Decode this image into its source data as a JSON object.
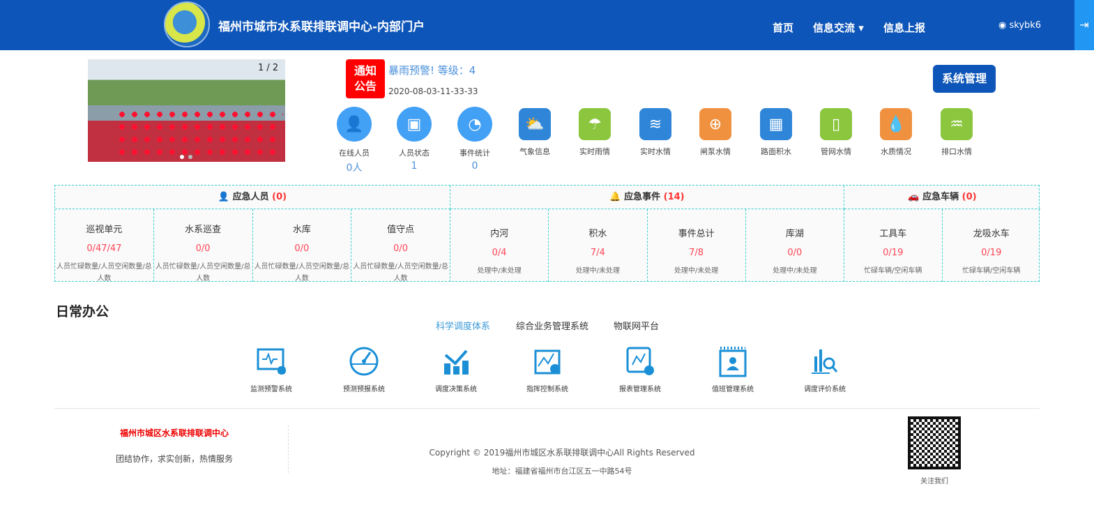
{
  "header": {
    "title": "福州市城市水系联排联调中心-内部门户",
    "nav": [
      "首页",
      "信息交流 ▾",
      "信息上报"
    ],
    "user": "skybk6",
    "logout_icon": "sign-out-icon"
  },
  "carousel": {
    "pager": "1 / 2"
  },
  "notice": {
    "badge": "通知公告",
    "title": "暴雨预警! 等级：4",
    "date": "2020-08-03-11-33-33"
  },
  "system_button": "系统管理",
  "quick": [
    {
      "label": "在线人员",
      "value": "0人",
      "color": "#42a0f5",
      "glyph": "👤"
    },
    {
      "label": "人员状态",
      "value": "1",
      "color": "#42a0f5",
      "glyph": "▣"
    },
    {
      "label": "事件统计",
      "value": "0",
      "color": "#42a0f5",
      "glyph": "◔"
    },
    {
      "label": "气象信息",
      "color": "#2f86d9",
      "glyph": "⛅"
    },
    {
      "label": "实时雨情",
      "color": "#8cc63f",
      "glyph": "☂"
    },
    {
      "label": "实时水情",
      "color": "#2f86d9",
      "glyph": "≋"
    },
    {
      "label": "闸泵水情",
      "color": "#f0913f",
      "glyph": "⊕"
    },
    {
      "label": "路面积水",
      "color": "#2f86d9",
      "glyph": "▦"
    },
    {
      "label": "管网水情",
      "color": "#8cc63f",
      "glyph": "▯"
    },
    {
      "label": "水质情况",
      "color": "#f0913f",
      "glyph": "💧"
    },
    {
      "label": "排口水情",
      "color": "#8cc63f",
      "glyph": "♒"
    }
  ],
  "emergency": {
    "groups": [
      {
        "title": "应急人员",
        "count": "(0)"
      },
      {
        "title": "应急事件",
        "count": "(14)"
      },
      {
        "title": "应急车辆",
        "count": "(0)"
      }
    ],
    "cells": [
      {
        "title": "巡视单元",
        "value": "0/47/47",
        "desc": "人员忙碌数量/人员空闲数量/总人数"
      },
      {
        "title": "水系巡查",
        "value": "0/0",
        "desc": "人员忙碌数量/人员空闲数量/总人数"
      },
      {
        "title": "水库",
        "value": "0/0",
        "desc": "人员忙碌数量/人员空闲数量/总人数"
      },
      {
        "title": "值守点",
        "value": "0/0",
        "desc": "人员忙碌数量/人员空闲数量/总人数"
      },
      {
        "title": "内河",
        "value": "0/4",
        "desc": "处理中/未处理"
      },
      {
        "title": "积水",
        "value": "7/4",
        "desc": "处理中/未处理"
      },
      {
        "title": "事件总计",
        "value": "7/8",
        "desc": "处理中/未处理"
      },
      {
        "title": "库湖",
        "value": "0/0",
        "desc": "处理中/未处理"
      },
      {
        "title": "工具车",
        "value": "0/19",
        "desc": "忙碌车辆/空闲车辆"
      },
      {
        "title": "龙吸水车",
        "value": "0/19",
        "desc": "忙碌车辆/空闲车辆"
      }
    ]
  },
  "daily": {
    "title": "日常办公",
    "tabs": [
      "科学调度体系",
      "综合业务管理系统",
      "物联网平台"
    ],
    "active_tab": 0,
    "systems": [
      "监测预警系统",
      "预测预报系统",
      "调度决策系统",
      "指挥控制系统",
      "报表管理系统",
      "值班管理系统",
      "调度评价系统"
    ]
  },
  "footer": {
    "org": "福州市城区水系联排联调中心",
    "slogan": "团结协作，求实创新，热情服务",
    "copyright": "Copyright © 2019福州市城区水系联排联调中心All Rights Reserved",
    "address": "地址：福建省福州市台江区五一中路54号",
    "qr_label": "关注我们"
  }
}
